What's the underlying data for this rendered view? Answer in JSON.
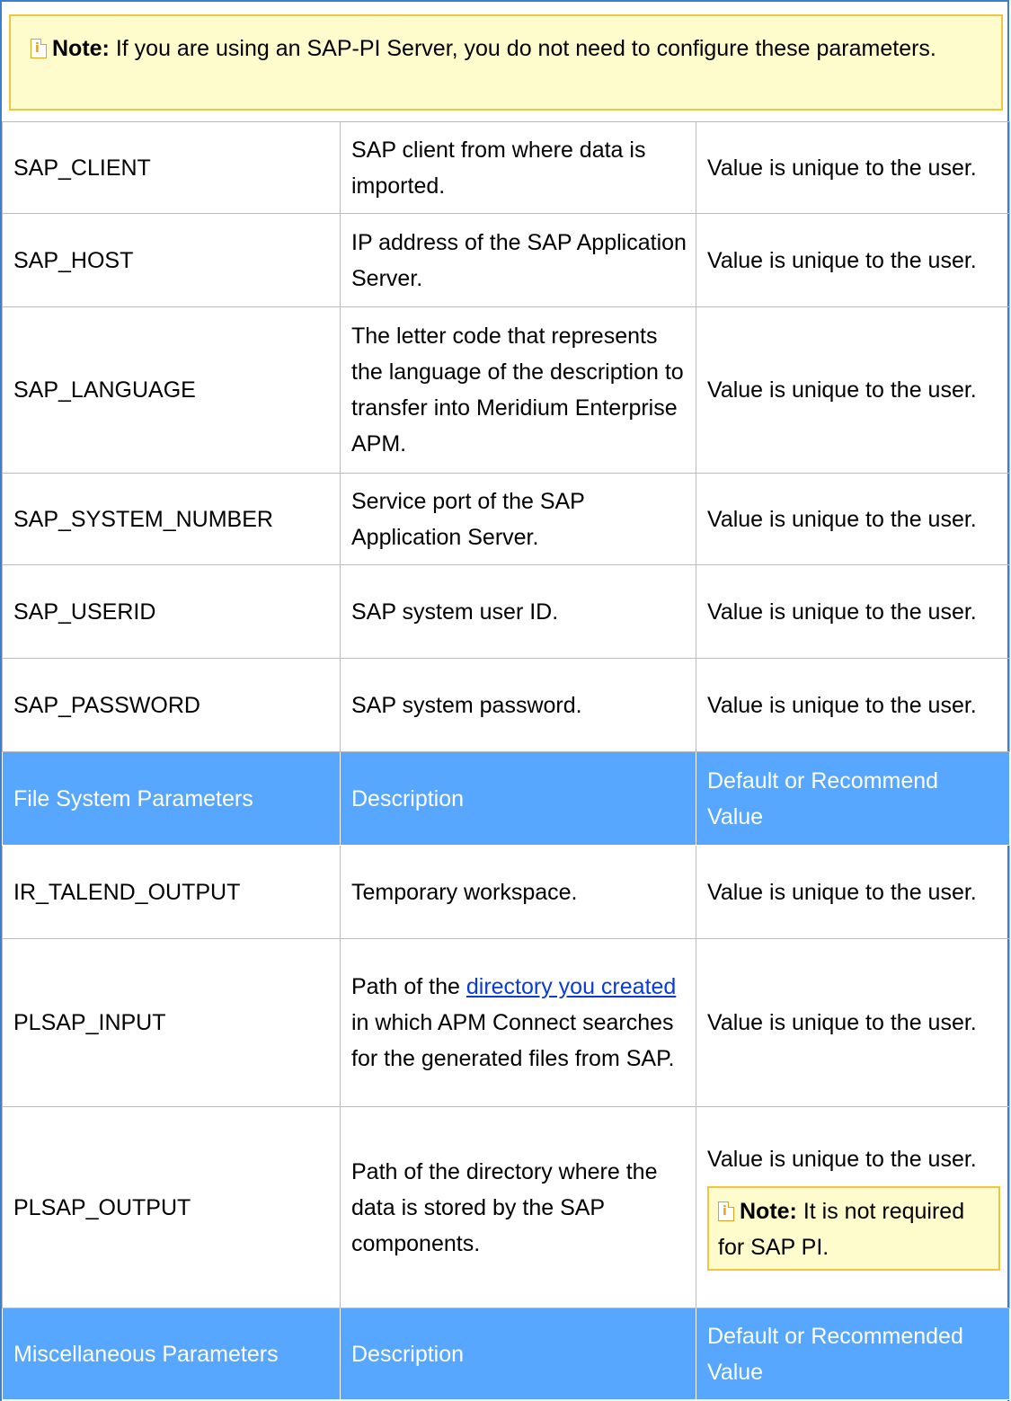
{
  "top_note": {
    "label": "Note:",
    "text": " If you are using an SAP-PI Server, you do not need to configure these para­meters."
  },
  "rows": [
    {
      "name": "SAP_CLIENT",
      "description": "SAP client from where data is imported.",
      "value": "Value is unique to the user."
    },
    {
      "name": "SAP_HOST",
      "description": "IP address of the SAP Applic­ation Server.",
      "value": "Value is unique to the user."
    },
    {
      "name": "SAP_LANGUAGE",
      "description": "The letter code that rep­resents the language of the description to transfer into Meridium Enterprise APM.",
      "value": "Value is unique to the user."
    },
    {
      "name": "SAP_SYSTEM_NUMBER",
      "description": "Service port of the SAP Application Server.",
      "value": "Value is unique to the user."
    },
    {
      "name": "SAP_USERID",
      "description": "SAP system user ID.",
      "value": "Value is unique to the user."
    },
    {
      "name": "SAP_PASSWORD",
      "description": "SAP system password.",
      "value": "Value is unique to the user."
    }
  ],
  "file_system_header": {
    "col1": "File System Parameters",
    "col2": "Description",
    "col3": "Default or Recommend Value"
  },
  "file_rows": {
    "ir_talend_output": {
      "name": "IR_TALEND_OUTPUT",
      "description": "Temporary workspace.",
      "value": "Value is unique to the user."
    },
    "plsap_input": {
      "name": "PLSAP_INPUT",
      "description_before": "Path of the ",
      "description_link": "directory you cre­ated",
      "description_after": " in which APM Connect searches for the generated files from SAP.",
      "value": "Value is unique to the user."
    },
    "plsap_output": {
      "name": "PLSAP_OUTPUT",
      "description": "Path of the directory where the data is stored by the SAP components.",
      "value": "Value is unique to the user.",
      "note_label": "Note:",
      "note_text": " It is not required for SAP PI."
    }
  },
  "misc_header": {
    "col1": "Miscellaneous Parameters",
    "col2": "Description",
    "col3": "Default or Recommended Value"
  },
  "colors": {
    "section_header": "#57a6ff",
    "note_background": "#fefbcc",
    "note_border": "#f0c63c",
    "link": "#0a3bd6",
    "frame": "#3b7fd0"
  }
}
